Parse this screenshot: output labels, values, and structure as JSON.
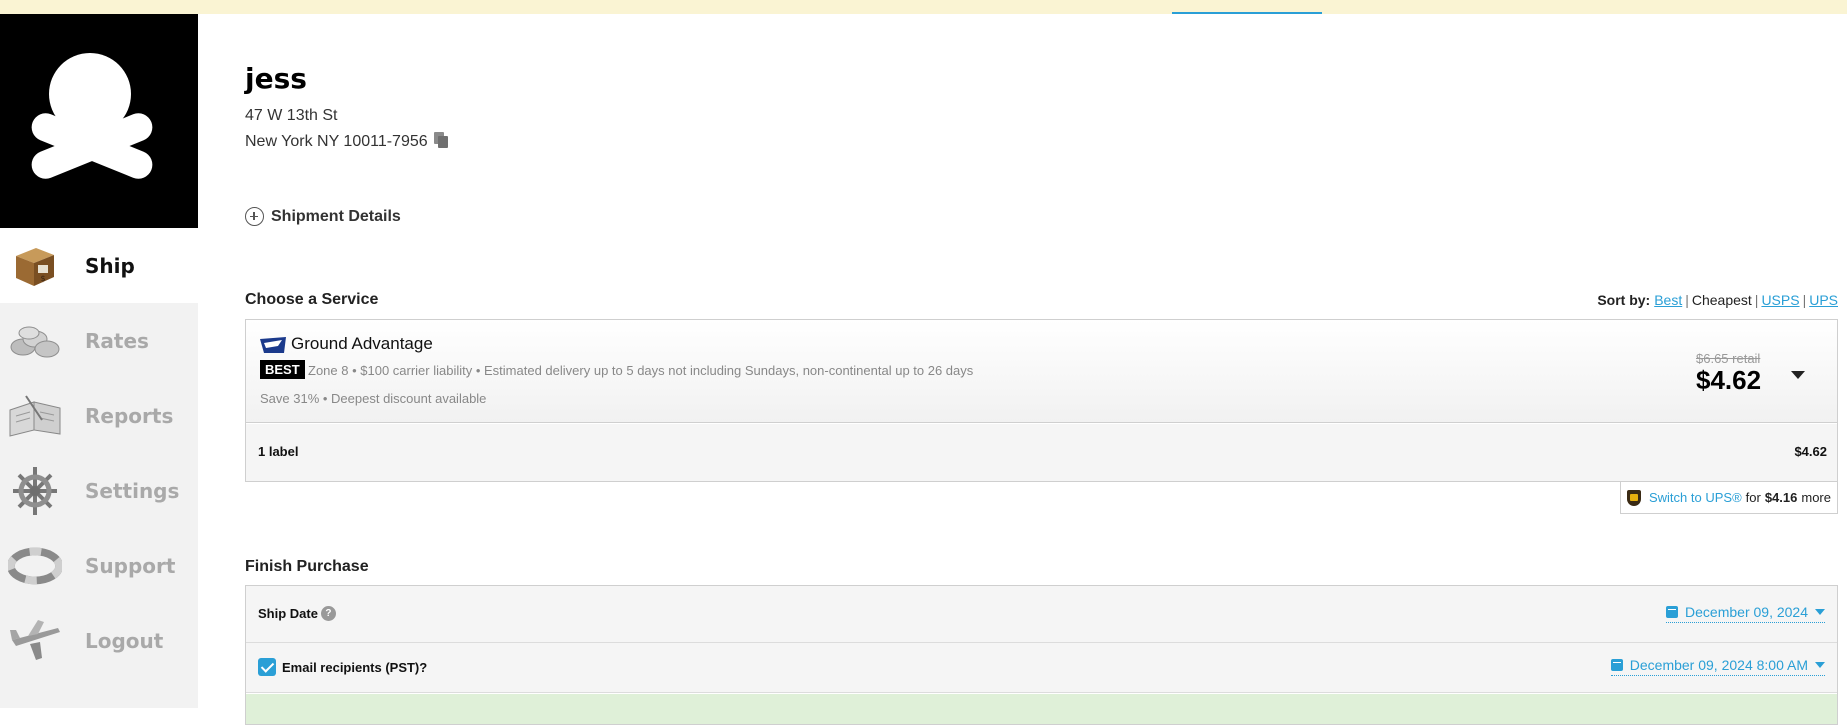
{
  "sidebar": {
    "items": [
      {
        "label": "Ship",
        "icon": "package-icon",
        "active": true
      },
      {
        "label": "Rates",
        "icon": "coins-icon",
        "active": false
      },
      {
        "label": "Reports",
        "icon": "book-icon",
        "active": false
      },
      {
        "label": "Settings",
        "icon": "ship-wheel-icon",
        "active": false
      },
      {
        "label": "Support",
        "icon": "life-ring-icon",
        "active": false
      },
      {
        "label": "Logout",
        "icon": "plane-icon",
        "active": false
      }
    ]
  },
  "recipient": {
    "name": "jess",
    "address_line1": "47 W 13th St",
    "address_line2": "New York NY 10011-7956"
  },
  "shipment_details": {
    "label": "Shipment Details"
  },
  "service": {
    "section_title": "Choose a Service",
    "sort": {
      "label": "Sort by:",
      "options": [
        "Best",
        "Cheapest",
        "USPS",
        "UPS"
      ],
      "current": "Cheapest"
    },
    "selected": {
      "carrier_icon": "usps-eagle-icon",
      "name": "Ground Advantage",
      "badge": "BEST",
      "description": "Zone 8 • $100 carrier liability • Estimated delivery up to 5 days not including Sundays, non-continental up to 26 days",
      "savings": "Save 31% • Deepest discount available",
      "retail_price": "$6.65 retail",
      "price": "$4.62"
    },
    "labels": {
      "count": "1 label",
      "total": "$4.62"
    },
    "switch": {
      "link": "Switch to UPS®",
      "for": "for",
      "price": "$4.16",
      "more": "more"
    }
  },
  "finish": {
    "section_title": "Finish Purchase",
    "ship_date": {
      "label": "Ship Date",
      "help": "?",
      "value": "December 09, 2024"
    },
    "email": {
      "label": "Email recipients (PST)?",
      "checked": true,
      "value": "December 09, 2024 8:00 AM"
    }
  },
  "colors": {
    "accent": "#2a9fd6",
    "success_bg": "#dff0d8",
    "notice_bg": "#faf4d3"
  }
}
